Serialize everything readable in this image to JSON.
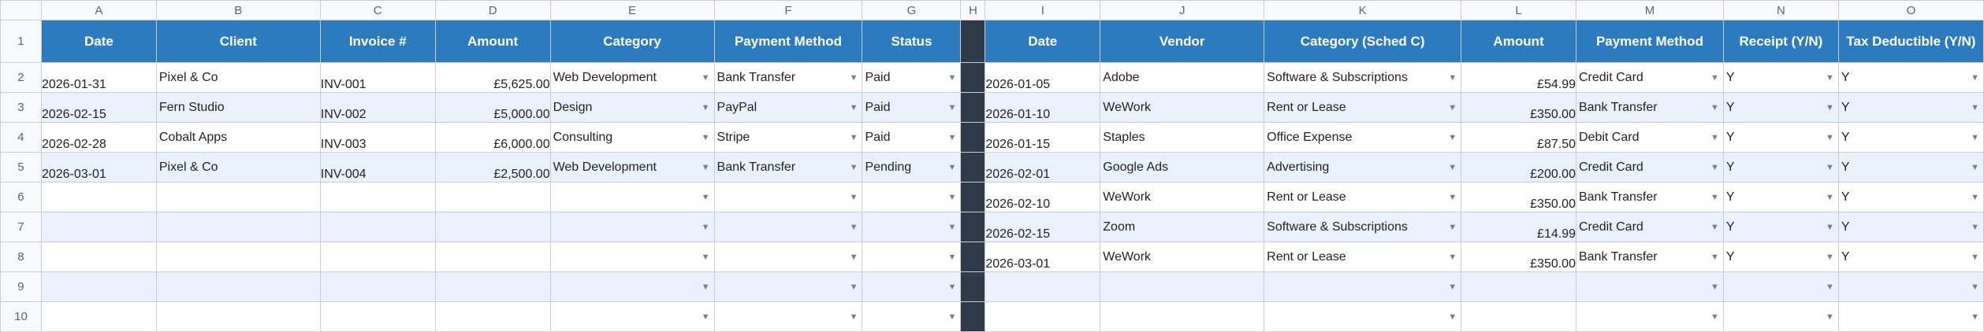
{
  "columns": [
    "",
    "A",
    "B",
    "C",
    "D",
    "E",
    "F",
    "G",
    "H",
    "I",
    "J",
    "K",
    "L",
    "M",
    "N",
    "O"
  ],
  "income_headers": [
    "Date",
    "Client",
    "Invoice #",
    "Amount",
    "Category",
    "Payment Method",
    "Status"
  ],
  "expense_headers": [
    "Date",
    "Vendor",
    "Category (Sched C)",
    "Amount",
    "Payment Method",
    "Receipt (Y/N)",
    "Tax Deductible (Y/N)"
  ],
  "income_rows": [
    [
      "2026-01-31",
      "Pixel & Co",
      "INV-001",
      "£5,625.00",
      "Web Development",
      "Bank Transfer",
      "Paid"
    ],
    [
      "2026-02-15",
      "Fern Studio",
      "INV-002",
      "£5,000.00",
      "Design",
      "PayPal",
      "Paid"
    ],
    [
      "2026-02-28",
      "Cobalt Apps",
      "INV-003",
      "£6,000.00",
      "Consulting",
      "Stripe",
      "Paid"
    ],
    [
      "2026-03-01",
      "Pixel & Co",
      "INV-004",
      "£2,500.00",
      "Web Development",
      "Bank Transfer",
      "Pending"
    ],
    [
      "",
      "",
      "",
      "",
      "",
      "",
      ""
    ],
    [
      "",
      "",
      "",
      "",
      "",
      "",
      ""
    ],
    [
      "",
      "",
      "",
      "",
      "",
      "",
      ""
    ],
    [
      "",
      "",
      "",
      "",
      "",
      "",
      ""
    ],
    [
      "",
      "",
      "",
      "",
      "",
      "",
      ""
    ]
  ],
  "expense_rows": [
    [
      "2026-01-05",
      "Adobe",
      "Software & Subscriptions",
      "£54.99",
      "Credit Card",
      "Y",
      "Y"
    ],
    [
      "2026-01-10",
      "WeWork",
      "Rent or Lease",
      "£350.00",
      "Bank Transfer",
      "Y",
      "Y"
    ],
    [
      "2026-01-15",
      "Staples",
      "Office Expense",
      "£87.50",
      "Debit Card",
      "Y",
      "Y"
    ],
    [
      "2026-02-01",
      "Google Ads",
      "Advertising",
      "£200.00",
      "Credit Card",
      "Y",
      "Y"
    ],
    [
      "2026-02-10",
      "WeWork",
      "Rent or Lease",
      "£350.00",
      "Bank Transfer",
      "Y",
      "Y"
    ],
    [
      "2026-02-15",
      "Zoom",
      "Software & Subscriptions",
      "£14.99",
      "Credit Card",
      "Y",
      "Y"
    ],
    [
      "2026-03-01",
      "WeWork",
      "Rent or Lease",
      "£350.00",
      "Bank Transfer",
      "Y",
      "Y"
    ],
    [
      "",
      "",
      "",
      "",
      "",
      "",
      ""
    ],
    [
      "",
      "",
      "",
      "",
      "",
      "",
      ""
    ]
  ],
  "colors": {
    "header_bg": "#2c7bbf",
    "alt_row_bg": "#e9f2fc",
    "separator": "#2f3a48"
  },
  "icons": {
    "dropdown": "dropdown-arrow-icon"
  }
}
